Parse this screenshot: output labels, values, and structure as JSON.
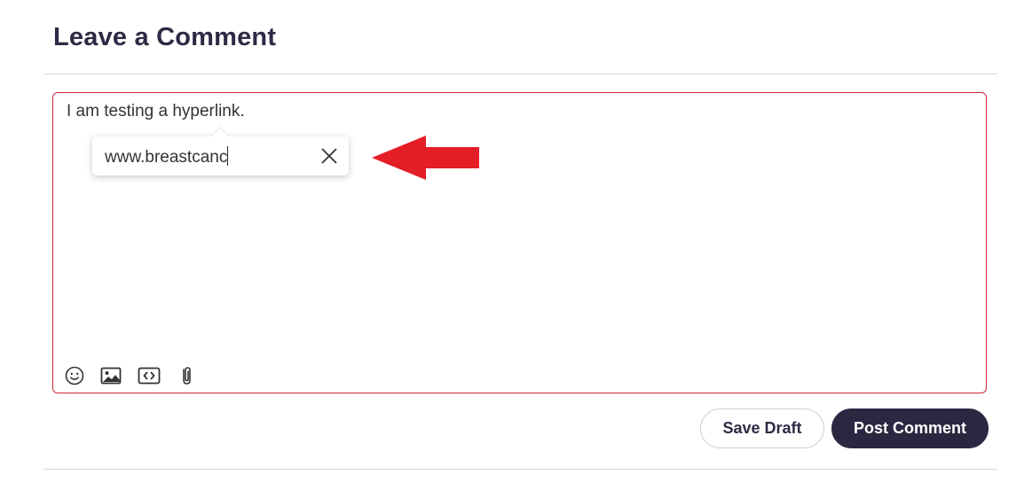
{
  "section": {
    "heading": "Leave a Comment"
  },
  "editor": {
    "text": "I am testing a hyperlink.",
    "link_popover": {
      "value": "www.breastcanc",
      "close_icon": "close-icon"
    },
    "toolbar": [
      {
        "name": "emoji-icon"
      },
      {
        "name": "image-icon"
      },
      {
        "name": "code-icon"
      },
      {
        "name": "attachment-icon"
      }
    ]
  },
  "annotation": {
    "arrow_color": "#e41e26",
    "arrow_icon": "left-arrow"
  },
  "actions": {
    "save_draft_label": "Save Draft",
    "post_comment_label": "Post Comment"
  },
  "colors": {
    "editor_border": "#c8283b",
    "primary_button": "#2d2640",
    "heading_text": "#2d2a44"
  }
}
